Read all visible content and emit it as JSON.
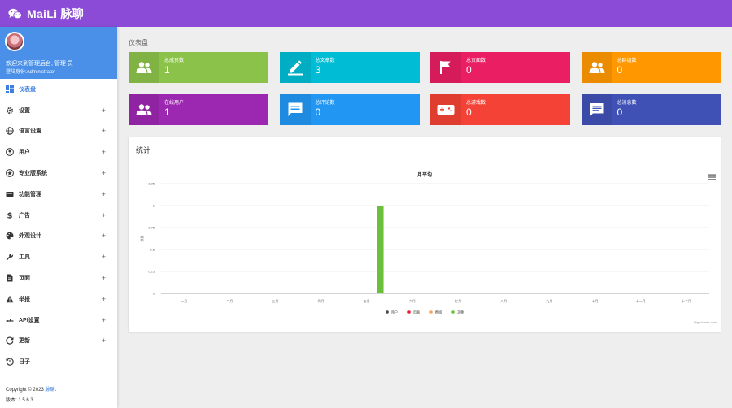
{
  "app": {
    "title": "MaiLi 脉聊"
  },
  "profile": {
    "welcome": "欢迎来到管理后台, 管理 员",
    "role": "登陆身份:Administrator"
  },
  "sidebar": {
    "items": [
      {
        "label": "仪表盘",
        "icon": "dashboard-icon",
        "active": true,
        "expandable": false
      },
      {
        "label": "设置",
        "icon": "gear-icon",
        "expandable": true
      },
      {
        "label": "语言设置",
        "icon": "globe-icon",
        "expandable": true
      },
      {
        "label": "用户",
        "icon": "user-icon",
        "expandable": true
      },
      {
        "label": "专业版系统",
        "icon": "star-icon",
        "expandable": true
      },
      {
        "label": "功能管理",
        "icon": "module-icon",
        "expandable": true
      },
      {
        "label": "广告",
        "icon": "dollar-icon",
        "expandable": true
      },
      {
        "label": "外观设计",
        "icon": "palette-icon",
        "expandable": true
      },
      {
        "label": "工具",
        "icon": "wrench-icon",
        "expandable": true
      },
      {
        "label": "页面",
        "icon": "page-icon",
        "expandable": true
      },
      {
        "label": "举报",
        "icon": "warning-icon",
        "expandable": true
      },
      {
        "label": "API设置",
        "icon": "api-icon",
        "expandable": true
      },
      {
        "label": "更新",
        "icon": "update-icon",
        "expandable": true
      },
      {
        "label": "日子",
        "icon": "history-icon",
        "expandable": false
      }
    ],
    "plus": "+"
  },
  "footer": {
    "copyright_prefix": "Copyright © 2023",
    "brand": "脉聊",
    "suffix": ".",
    "version": "版本: 1.5.6.3"
  },
  "main": {
    "page_title": "仪表盘",
    "cards": [
      {
        "label": "总成员数",
        "value": "1",
        "color": "#8bc34a",
        "icon": "users-icon"
      },
      {
        "label": "总文章数",
        "value": "3",
        "color": "#00bcd4",
        "icon": "pencil-icon"
      },
      {
        "label": "总页面数",
        "value": "0",
        "color": "#e91e63",
        "icon": "flag-icon"
      },
      {
        "label": "总群组数",
        "value": "0",
        "color": "#ff9800",
        "icon": "group-icon"
      },
      {
        "label": "在线用户",
        "value": "1",
        "color": "#9c27b0",
        "icon": "users-icon"
      },
      {
        "label": "总评论数",
        "value": "0",
        "color": "#2196f3",
        "icon": "comment-icon"
      },
      {
        "label": "总游戏数",
        "value": "0",
        "color": "#f44336",
        "icon": "gamepad-icon"
      },
      {
        "label": "总消息数",
        "value": "0",
        "color": "#3f51b5",
        "icon": "message-icon"
      }
    ],
    "stats_title": "统计",
    "credits": "Highcharts.com"
  },
  "chart_data": {
    "type": "bar",
    "title": "月平均",
    "ylabel": "数量",
    "categories": [
      "一月",
      "二月",
      "三月",
      "四月",
      "五月",
      "六月",
      "七月",
      "八月",
      "九月",
      "十月",
      "十一月",
      "十二月"
    ],
    "ylim": [
      0,
      1.25
    ],
    "yticks": [
      "0",
      "0.25",
      "0.5",
      "0.75",
      "1",
      "1.25"
    ],
    "grid": true,
    "legend_position": "bottom",
    "series": [
      {
        "name": "用户",
        "color": "#434348",
        "values": [
          0,
          0,
          0,
          0,
          0,
          0,
          0,
          0,
          0,
          0,
          0,
          0
        ]
      },
      {
        "name": "页面",
        "color": "#e8212d",
        "values": [
          0,
          0,
          0,
          0,
          0,
          0,
          0,
          0,
          0,
          0,
          0,
          0
        ]
      },
      {
        "name": "群组",
        "color": "#f7a35c",
        "values": [
          0,
          0,
          0,
          0,
          0,
          0,
          0,
          0,
          0,
          0,
          0,
          0
        ]
      },
      {
        "name": "文章",
        "color": "#6cbf3a",
        "values": [
          0,
          0,
          0,
          0,
          1,
          0,
          0,
          0,
          0,
          0,
          0,
          0
        ]
      }
    ]
  }
}
